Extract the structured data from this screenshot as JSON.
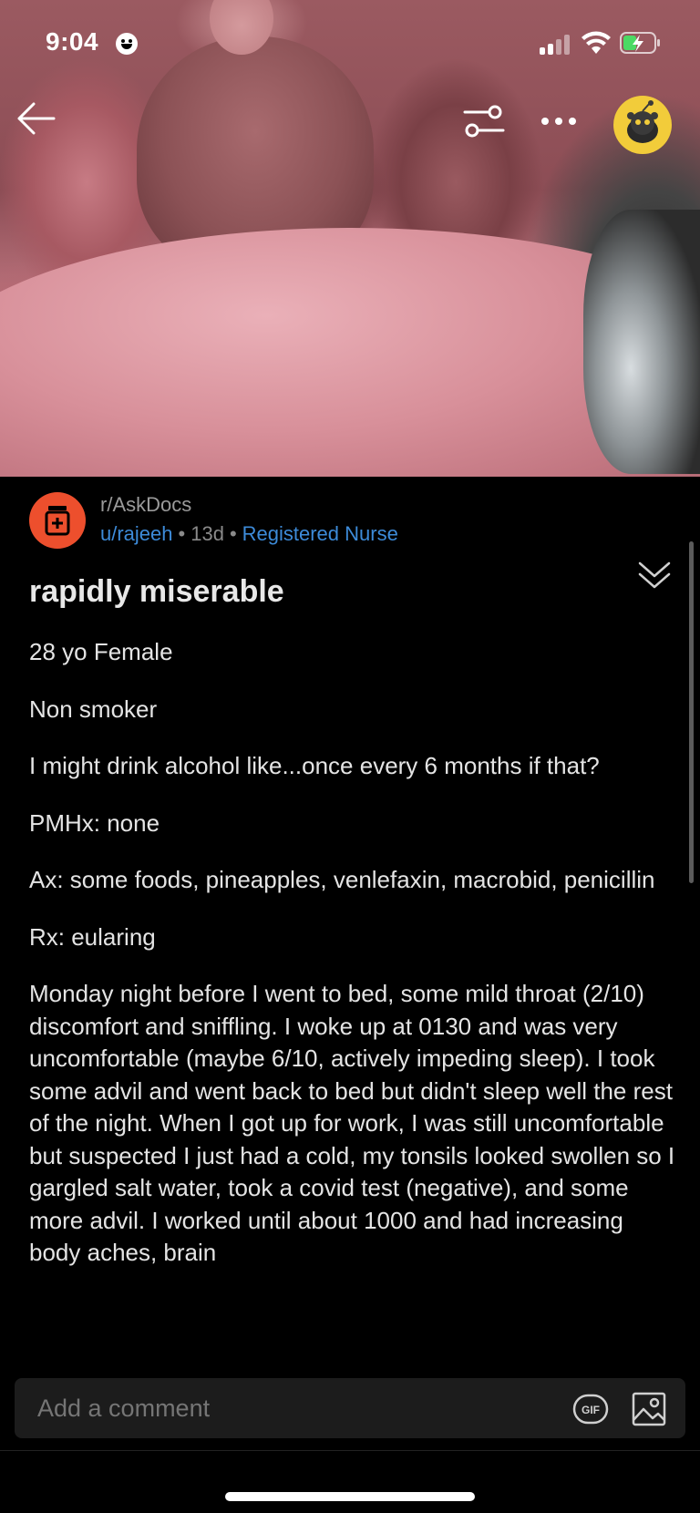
{
  "status_bar": {
    "time": "9:04"
  },
  "header": {
    "icons": [
      "back-arrow-icon",
      "sort-filter-icon",
      "more-options-icon",
      "user-avatar-icon"
    ]
  },
  "post": {
    "subreddit": "r/AskDocs",
    "author": "u/rajeeh",
    "age": "13d",
    "flair": "Registered Nurse",
    "separator": "•",
    "title": "rapidly miserable",
    "body": [
      "28 yo Female",
      "Non smoker",
      "I might drink alcohol like...once every 6 months if that?",
      "PMHx: none",
      "Ax: some foods, pineapples, venlefaxin, macrobid, penicillin",
      "Rx: eularing",
      "Monday night before I went to bed, some mild throat (2/10) discomfort and sniffling. I woke up at 0130 and was very uncomfortable (maybe 6/10, actively impeding sleep). I took some advil and went back to bed but didn't sleep well the rest of the night. When I got up for work, I was still uncomfortable but suspected I just had a cold, my tonsils looked swollen so I gargled salt water, took a covid test (negative), and some more advil. I worked until about 1000 and had increasing body aches, brain"
    ]
  },
  "comment_bar": {
    "placeholder": "Add a comment",
    "gif_label": "GIF"
  },
  "colors": {
    "link_blue": "#3d8bd9",
    "subreddit_icon_bg": "#ed4f2d",
    "avatar_bg": "#f2cc3a",
    "background": "#000000"
  }
}
